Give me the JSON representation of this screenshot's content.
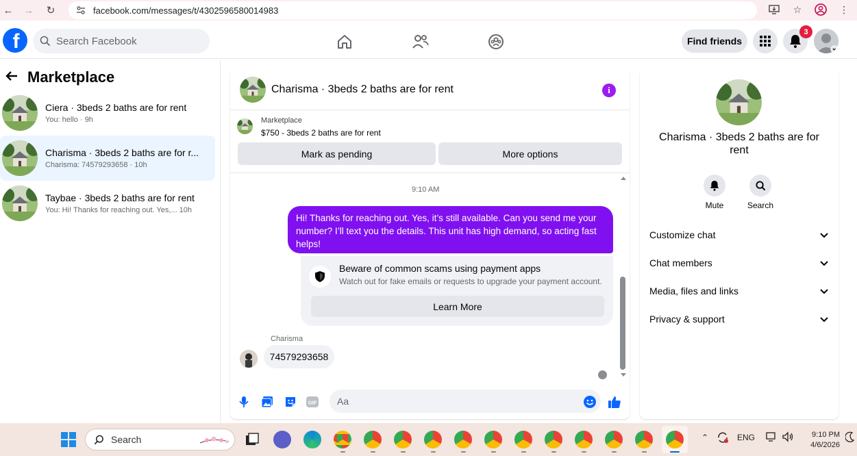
{
  "browser": {
    "url": "facebook.com/messages/t/4302596580014983"
  },
  "header": {
    "search_placeholder": "Search Facebook",
    "find_friends": "Find friends",
    "notif_count": "3",
    "logo_letter": "f"
  },
  "sidebar": {
    "title": "Marketplace",
    "conversations": [
      {
        "title": "Ciera · 3beds 2 baths are for rent",
        "sub": "You: hello · 9h",
        "active": false
      },
      {
        "title": "Charisma · 3beds 2 baths are for r...",
        "sub": "Charisma: 74579293658 · 10h",
        "active": true
      },
      {
        "title": "Taybae · 3beds 2 baths are for rent",
        "sub": "You: Hi! Thanks for reaching out. Yes,...   10h",
        "active": false
      }
    ]
  },
  "chat": {
    "title": "Charisma · 3beds 2 baths are for rent",
    "marketplace_label": "Marketplace",
    "listing": "$750 - 3beds 2 baths are for rent",
    "mark_pending": "Mark as pending",
    "more_options": "More options",
    "timestamp": "9:10 AM",
    "outgoing_message": "Hi! Thanks for reaching out. Yes, it’s still available. Can you send me your number? I’ll text you the details. This unit has high demand, so acting fast helps!",
    "scam_title": "Beware of common scams using payment apps",
    "scam_sub": "Watch out for fake emails or requests to upgrade your payment account.",
    "learn_more": "Learn More",
    "sender_name": "Charisma",
    "incoming_message": "74579293658",
    "input_placeholder": "Aa",
    "gif_label": "GIF",
    "accent": "#8010f0"
  },
  "details": {
    "name": "Charisma · 3beds 2 baths are for rent",
    "mute": "Mute",
    "search": "Search",
    "rows": [
      "Customize chat",
      "Chat members",
      "Media, files and links",
      "Privacy & support"
    ]
  },
  "taskbar": {
    "search": "Search",
    "lang": "ENG",
    "time": "9:10 PM",
    "date": "4/6/2026"
  }
}
